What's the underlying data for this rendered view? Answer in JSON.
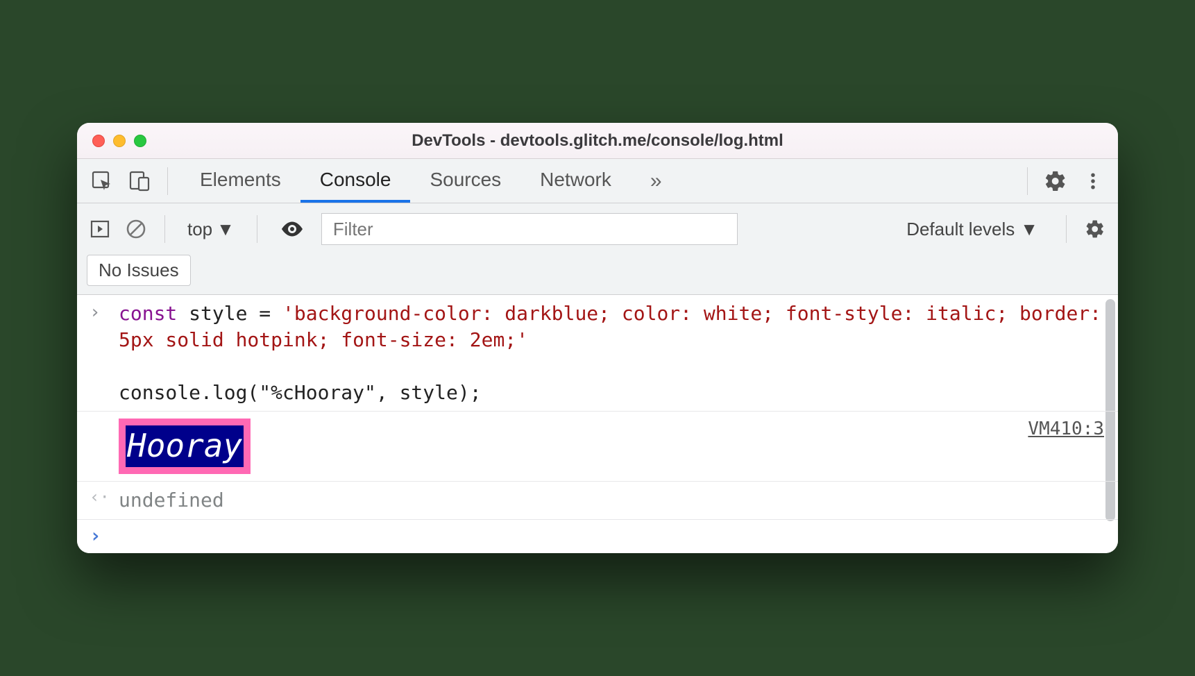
{
  "window": {
    "title": "DevTools - devtools.glitch.me/console/log.html"
  },
  "tabs": {
    "elements": "Elements",
    "console": "Console",
    "sources": "Sources",
    "network": "Network"
  },
  "toolbar": {
    "context": "top",
    "filter_placeholder": "Filter",
    "levels": "Default levels",
    "no_issues": "No Issues"
  },
  "console": {
    "input_code": {
      "kw": "const",
      "var": " style = ",
      "str": "'background-color: darkblue; color: white; font-style: italic; border: 5px solid hotpink; font-size: 2em;'",
      "line2": "console.log(\"%cHooray\", style);"
    },
    "output_text": "Hooray",
    "output_source": "VM410:3",
    "return_value": "undefined"
  }
}
